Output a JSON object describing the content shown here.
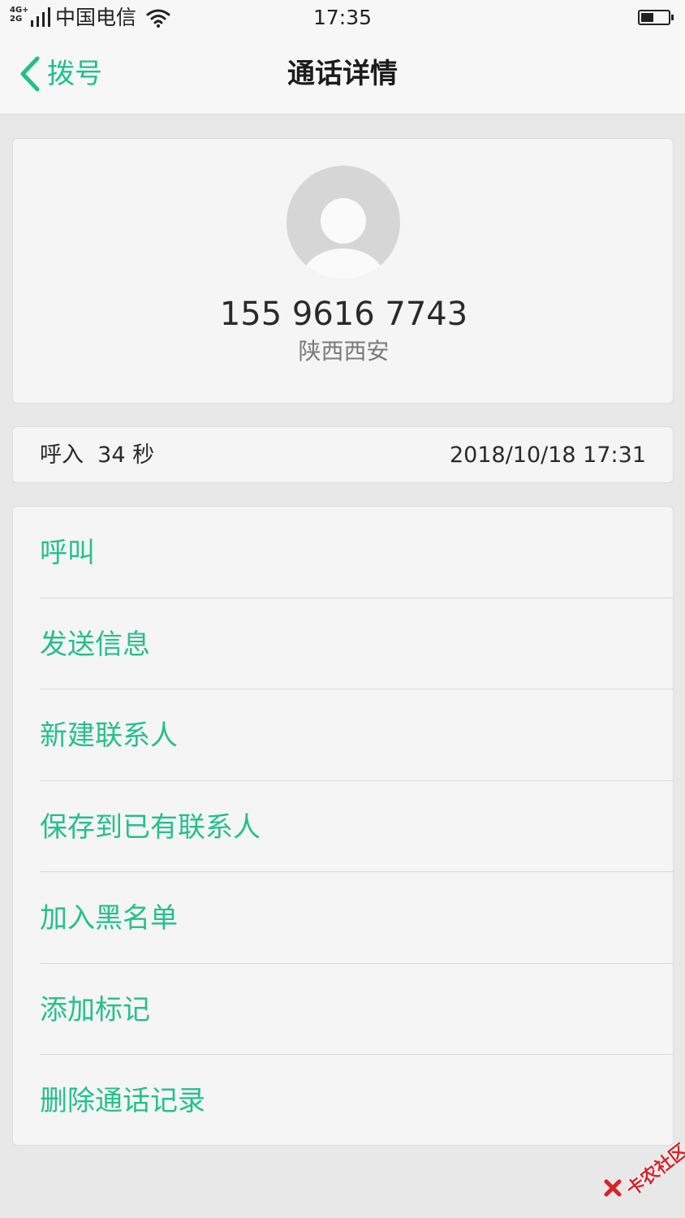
{
  "status_bar": {
    "network_top": "4G+",
    "network_bottom": "2G",
    "carrier": "中国电信",
    "time": "17:35",
    "icons": [
      "signal-icon",
      "wifi-icon",
      "battery-icon"
    ]
  },
  "nav": {
    "back_label": "拨号",
    "title": "通话详情"
  },
  "contact": {
    "phone_number": "155 9616 7743",
    "location": "陕西西安"
  },
  "call_record": {
    "summary": "呼入  34 秒",
    "datetime": "2018/10/18 17:31"
  },
  "actions": [
    {
      "label": "呼叫"
    },
    {
      "label": "发送信息"
    },
    {
      "label": "新建联系人"
    },
    {
      "label": "保存到已有联系人"
    },
    {
      "label": "加入黑名单"
    },
    {
      "label": "添加标记"
    },
    {
      "label": "删除通话记录"
    }
  ],
  "watermark": {
    "text": "卡农社区"
  },
  "colors": {
    "accent": "#20c08a",
    "background": "#e8e8e8",
    "card": "#f5f5f5"
  }
}
